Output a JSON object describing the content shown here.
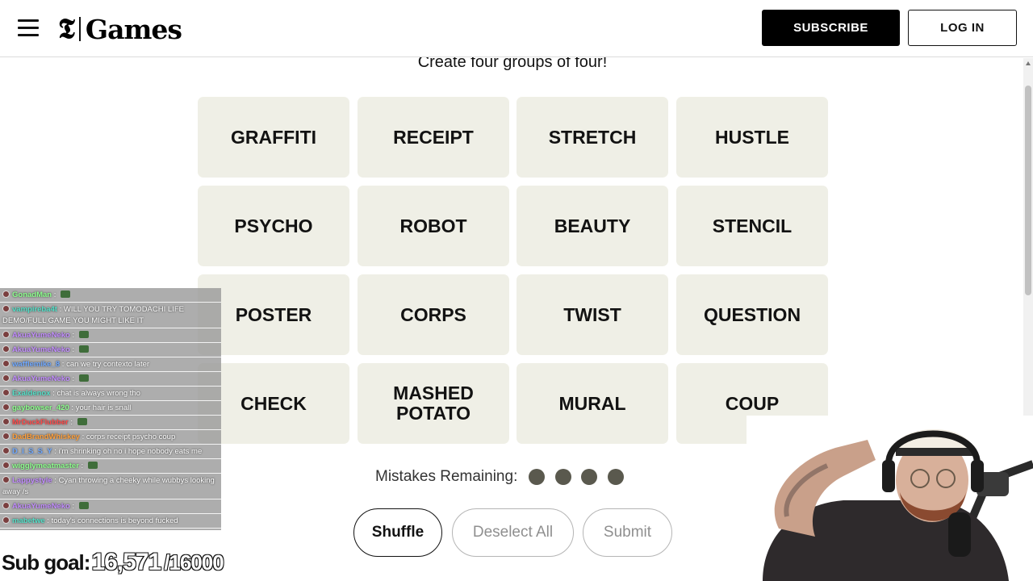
{
  "header": {
    "menu_icon": "hamburger-menu-icon",
    "logo_mark": "𝕿",
    "logo_text": "Games",
    "subscribe_label": "SUBSCRIBE",
    "login_label": "LOG IN"
  },
  "game": {
    "subtitle": "Create four groups of four!",
    "tiles": [
      "GRAFFITI",
      "RECEIPT",
      "STRETCH",
      "HUSTLE",
      "PSYCHO",
      "ROBOT",
      "BEAUTY",
      "STENCIL",
      "POSTER",
      "CORPS",
      "TWIST",
      "QUESTION",
      "CHECK",
      "MASHED POTATO",
      "MURAL",
      "COUP"
    ],
    "mistakes_label": "Mistakes Remaining:",
    "mistakes_remaining": 4,
    "buttons": {
      "shuffle": "Shuffle",
      "deselect_all": "Deselect All",
      "submit": "Submit"
    }
  },
  "stream_overlay": {
    "chat": [
      {
        "user": "GonadMan",
        "text": ""
      },
      {
        "user": "vampireba4t",
        "text": "WILL YOU TRY TOMODACHI LIFE DEMO/FULL GAME YOU MIGHT LIKE IT"
      },
      {
        "user": "AkuaYumeNeko",
        "text": ""
      },
      {
        "user": "AkuaYumeNeko",
        "text": ""
      },
      {
        "user": "wafflemike_8",
        "text": "can we try contexto later"
      },
      {
        "user": "AkuaYumeNeko",
        "text": ""
      },
      {
        "user": "Exaldenox",
        "text": "chat is always wrong tho"
      },
      {
        "user": "gaybowser_420",
        "text": "your hair is snall"
      },
      {
        "user": "MrDuckFlubber",
        "text": ""
      },
      {
        "user": "DadBrandWhiskey",
        "text": "corps receipt psycho coup"
      },
      {
        "user": "D_I_S_S_Y",
        "text": "i'm shrinking oh no i hope nobody eats me"
      },
      {
        "user": "wigglymeatmaster",
        "text": ""
      },
      {
        "user": "Lappystyle",
        "text": "Cyan throwing a cheeky while wubbys looking away /s"
      },
      {
        "user": "AkuaYumeNeko",
        "text": ""
      },
      {
        "user": "mabetwe",
        "text": "today's connections is beyond fucked"
      }
    ],
    "sub_goal_label": "Sub goal:",
    "sub_goal_value": "16,571",
    "sub_goal_target": "/16000",
    "colors": {
      "user_green": "#8cff8c",
      "user_blue": "#6fa8ff",
      "user_purple": "#c28cff",
      "user_orange": "#ff9f3a",
      "user_red": "#ff4a4a",
      "user_teal": "#53e0c8"
    }
  },
  "colors": {
    "tile_bg": "#efefe6",
    "dot": "#5a594e",
    "brand_black": "#000000"
  }
}
